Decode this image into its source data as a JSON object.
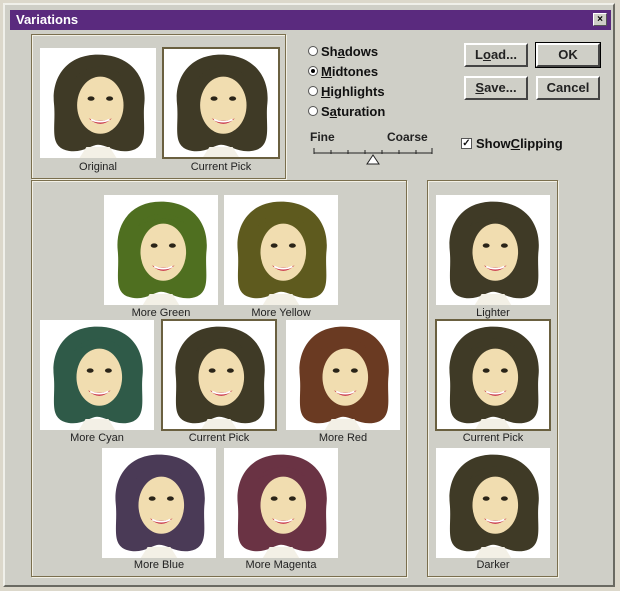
{
  "window": {
    "title": "Variations",
    "close_glyph": "×"
  },
  "top_preview": {
    "original_caption": "Original",
    "current_caption": "Current Pick"
  },
  "tone_options": [
    {
      "label_pre": "Sh",
      "label_u": "a",
      "label_post": "dows",
      "selected": false
    },
    {
      "label_pre": "",
      "label_u": "M",
      "label_post": "idtones",
      "selected": true
    },
    {
      "label_pre": "",
      "label_u": "H",
      "label_post": "ighlights",
      "selected": false
    },
    {
      "label_pre": "S",
      "label_u": "a",
      "label_post": "turation",
      "selected": false
    }
  ],
  "slider": {
    "fine_label": "Fine",
    "coarse_label": "Coarse"
  },
  "buttons": {
    "load_pre": "L",
    "load_u": "o",
    "load_post": "ad...",
    "ok": "OK",
    "save_pre": "",
    "save_u": "S",
    "save_post": "ave...",
    "cancel": "Cancel"
  },
  "show_clipping": {
    "label_pre": "Show ",
    "label_u": "C",
    "label_post": "lipping",
    "checked": true,
    "check_glyph": "✓"
  },
  "hue_grid": {
    "more_green": "More Green",
    "more_yellow": "More Yellow",
    "more_cyan": "More Cyan",
    "current_pick": "Current Pick",
    "more_red": "More Red",
    "more_blue": "More Blue",
    "more_magenta": "More Magenta"
  },
  "brightness": {
    "lighter": "Lighter",
    "current_pick": "Current Pick",
    "darker": "Darker"
  },
  "colors": {
    "titlebar": "#5a2a7e",
    "original_hair": "#3f3a26",
    "green_hair": "#4f6f20",
    "yellow_hair": "#5e5a1e",
    "cyan_hair": "#2f5a48",
    "red_hair": "#6a3a22",
    "blue_hair": "#4a3a56",
    "magenta_hair": "#6a3344"
  }
}
